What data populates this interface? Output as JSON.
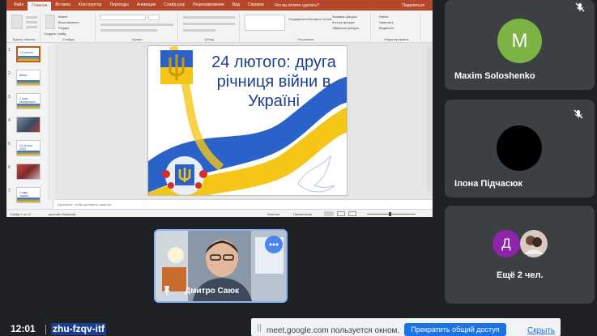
{
  "ppt": {
    "tabs": [
      "Файл",
      "Главная",
      "Вставка",
      "Конструктор",
      "Переходы",
      "Анимация",
      "Слайд-шоу",
      "Рецензирование",
      "Вид",
      "Справка"
    ],
    "tell_me": "Что вы хотите сделать?",
    "share": "Поделиться",
    "ribbon_groups": [
      "Буфер обмена",
      "Слайды",
      "Шрифт",
      "Абзац",
      "Рисование",
      "Редактирование"
    ],
    "ribbon_small": [
      "Макет",
      "Восстановить",
      "Раздел",
      "Создать слайд",
      "Найти",
      "Заменить",
      "Выделить",
      "Заливка фигуры",
      "Контур фигуры",
      "Эффекты фигуры",
      "Упорядочить",
      "Экспресс-стили"
    ],
    "thumbs": [
      {
        "num": "1",
        "text": "24 лютого"
      },
      {
        "num": "2",
        "text": "Війна"
      },
      {
        "num": "3",
        "text": "2 роки незламності"
      },
      {
        "num": "4",
        "text": ""
      },
      {
        "num": "5",
        "text": "24 лютого 2022"
      },
      {
        "num": "6",
        "text": ""
      },
      {
        "num": "7",
        "text": "Слава Україні"
      }
    ],
    "slide_title": "24 лютого: друга річниця війни в Україні",
    "notes_placeholder": "Щелкните, чтобы добавить заметки",
    "status": {
      "slide_count": "Слайд 1 из 12",
      "language": "русский (Украина)",
      "notes": "Заметки",
      "comments": "Примечания"
    },
    "accent": "#b7472a"
  },
  "participants": [
    {
      "name": "Maxim Soloshenko",
      "initial": "M",
      "avatar_color": "#7cb342"
    },
    {
      "name": "Ілона Підчасюк",
      "initial": "",
      "avatar_color": "#000000"
    },
    {
      "name": "Ещё 2 чел.",
      "initial": "Д",
      "avatar_color": "#8e24aa"
    }
  ],
  "presenter": {
    "name": "Дмитро Саюк"
  },
  "footer": {
    "time": "12:01",
    "meeting_code": "zhu-fzqv-itf"
  },
  "share_bar": {
    "message": "meet.google.com пользуется окном.",
    "stop_label": "Прекратить общий доступ",
    "hide_label": "Скрыть"
  }
}
